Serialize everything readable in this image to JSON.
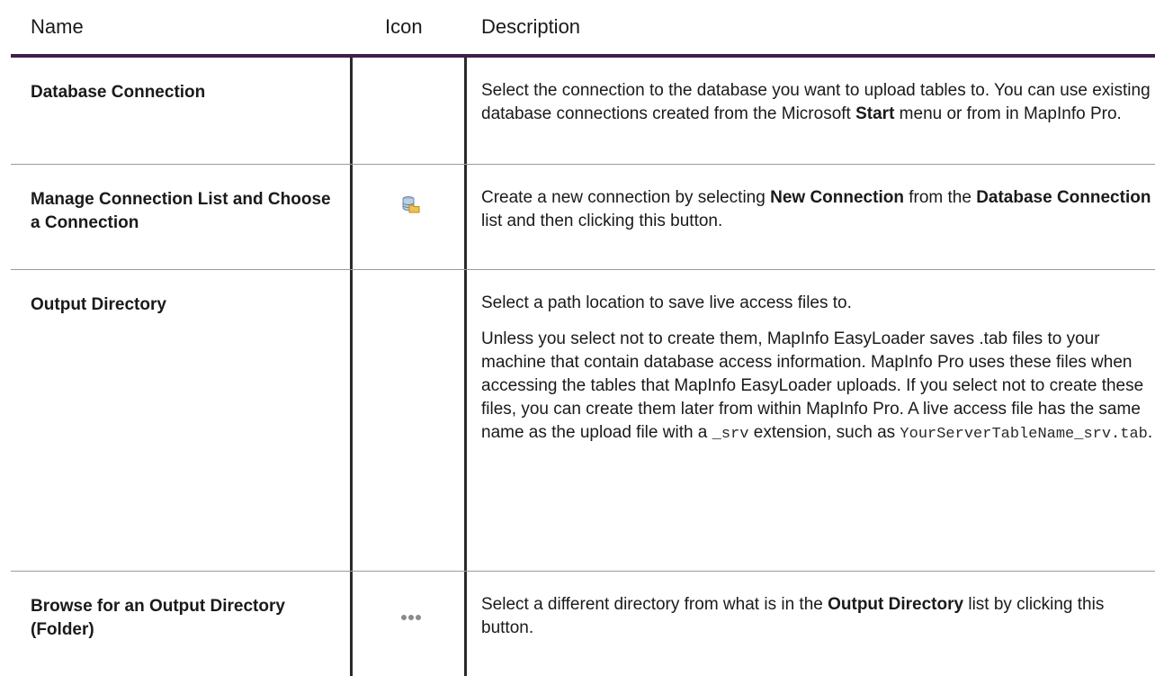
{
  "header": {
    "name": "Name",
    "icon": "Icon",
    "description": "Description"
  },
  "rows": [
    {
      "name": "Database Connection",
      "icon": "",
      "desc_p1_a": "Select the connection to the database you want to upload tables to. You can use existing database connections created from the Microsoft ",
      "desc_p1_b": "Start",
      "desc_p1_c": " menu or from in MapInfo Pro."
    },
    {
      "name": "Manage Connection List and Choose a Connection",
      "icon": "database-folder-icon",
      "desc_a": "Create a new connection by selecting ",
      "desc_b": "New Connection",
      "desc_c": " from the ",
      "desc_d": "Database Connection",
      "desc_e": " list and then clicking this button."
    },
    {
      "name": "Output Directory",
      "icon": "",
      "desc_p1": "Select a path location to save live access files to.",
      "desc_p2_a": "Unless you select not to create them, MapInfo EasyLoader saves .tab files to your machine that contain database access information. MapInfo Pro uses these files when accessing the tables that MapInfo EasyLoader uploads. If you select not to create these files, you can create them later from within MapInfo Pro. A live access file has the same name as the upload file with a ",
      "desc_p2_code1": "_srv",
      "desc_p2_b": " extension, such as ",
      "desc_p2_code2": "YourServerTableName_srv.tab",
      "desc_p2_c": "."
    },
    {
      "name": "Browse for an Output Directory (Folder)",
      "icon": "ellipsis-icon",
      "desc_a": "Select a different directory from what is in the ",
      "desc_b": "Output Directory",
      "desc_c": " list by clicking this button."
    }
  ],
  "colors": {
    "header_rule": "#3f1f48",
    "column_rule": "#2a2a2a",
    "row_rule": "#9a9a9a"
  }
}
